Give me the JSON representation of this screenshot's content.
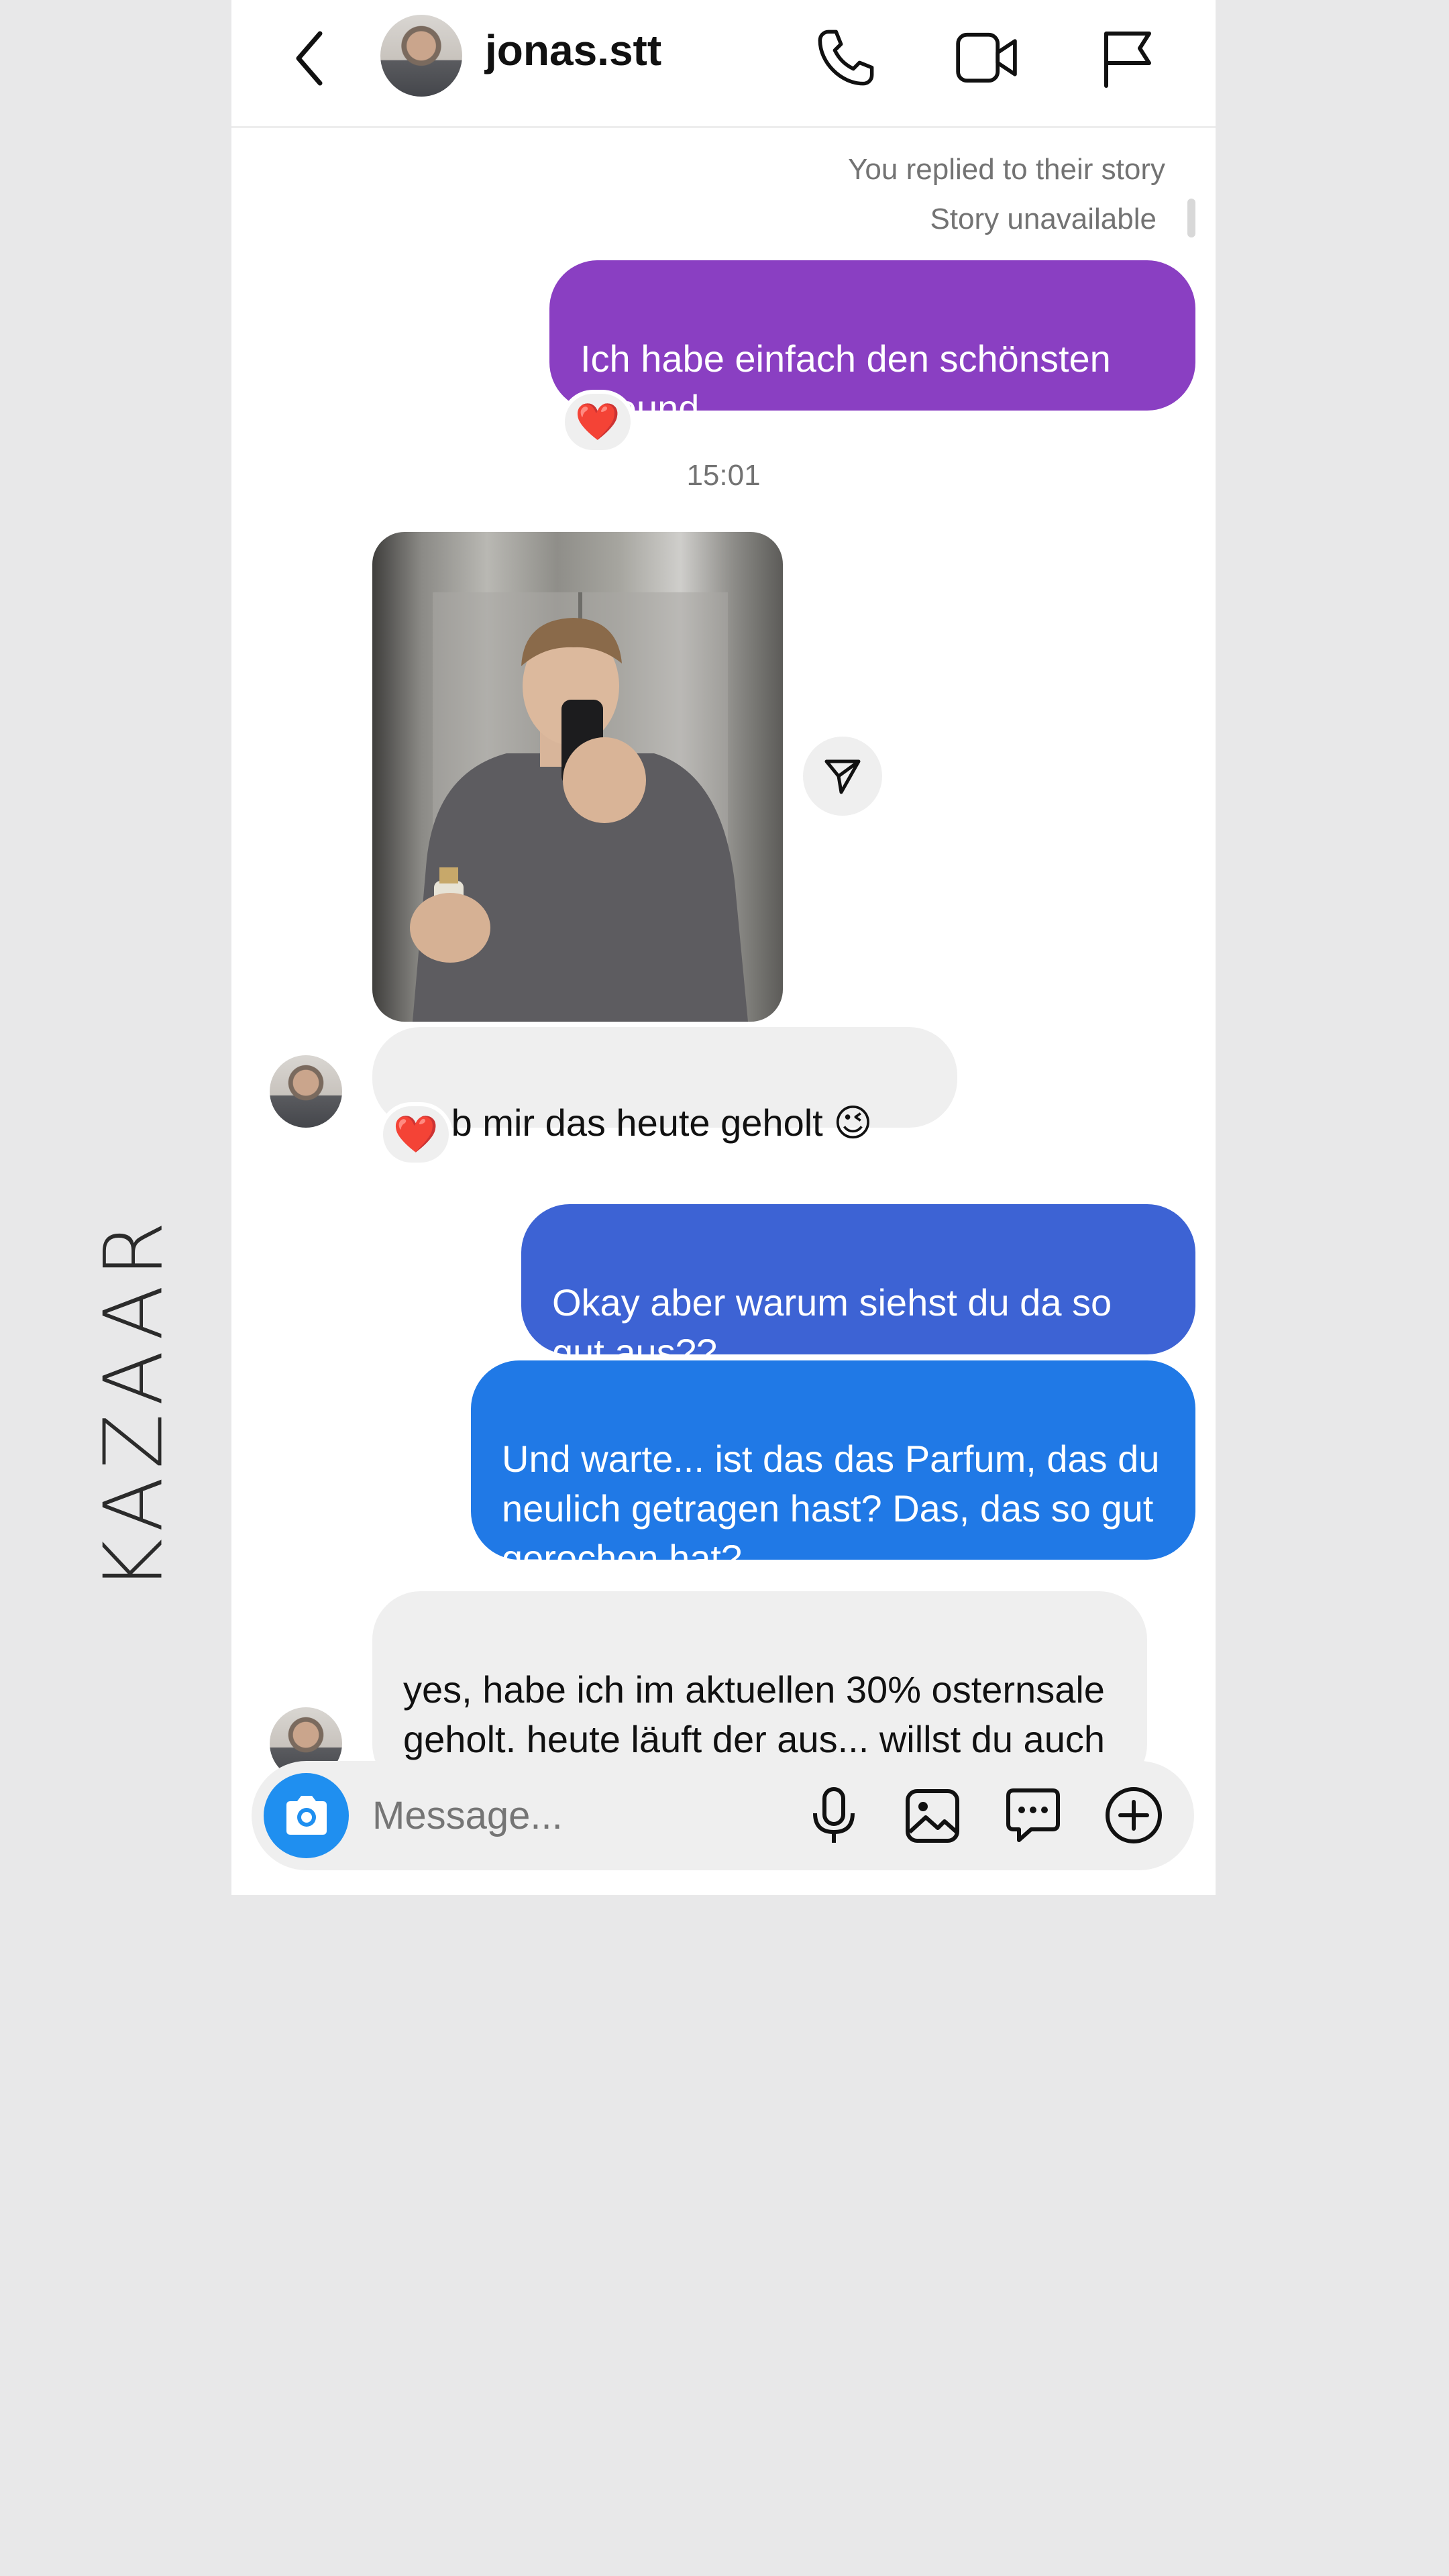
{
  "brand": {
    "wordmark": "KAZAAR"
  },
  "header": {
    "username": "jonas.stt",
    "icons": [
      "back-chevron-icon",
      "avatar",
      "phone-icon",
      "video-camera-icon",
      "flag-icon"
    ]
  },
  "thread": {
    "story_reply_note": "You replied to their story",
    "story_unavailable": "Story unavailable",
    "messages": [
      {
        "from": "me",
        "text": "Ich habe einfach den schönsten Freund",
        "reaction": "❤️"
      },
      {
        "timestamp": "15:01"
      },
      {
        "from": "jonas.stt",
        "type": "photo",
        "alt": "mirror-selfie-with-perfume"
      },
      {
        "from": "jonas.stt",
        "text": "Hab mir das heute geholt 😉",
        "reaction": "❤️"
      },
      {
        "from": "me",
        "text": "Okay aber warum siehst du da so gut aus??"
      },
      {
        "from": "me",
        "text": "Und warte... ist das das Parfum, das du neulich getragen hast? Das, das so gut gerochen hat?"
      },
      {
        "from": "jonas.stt",
        "text": "yes, habe ich im aktuellen 30% osternsale geholt. heute läuft der aus... willst du auch was geht auf mich 😋"
      }
    ]
  },
  "composer": {
    "placeholder": "Message...",
    "icons": [
      "camera-icon",
      "microphone-icon",
      "gallery-icon",
      "sticker-icon",
      "plus-icon"
    ]
  },
  "colors": {
    "bubble_purple": "#8a3fc2",
    "bubble_indigo": "#3d63d4",
    "bubble_blue": "#2079e6",
    "bubble_incoming": "#efefef",
    "camera_button": "#1f8ff0"
  }
}
